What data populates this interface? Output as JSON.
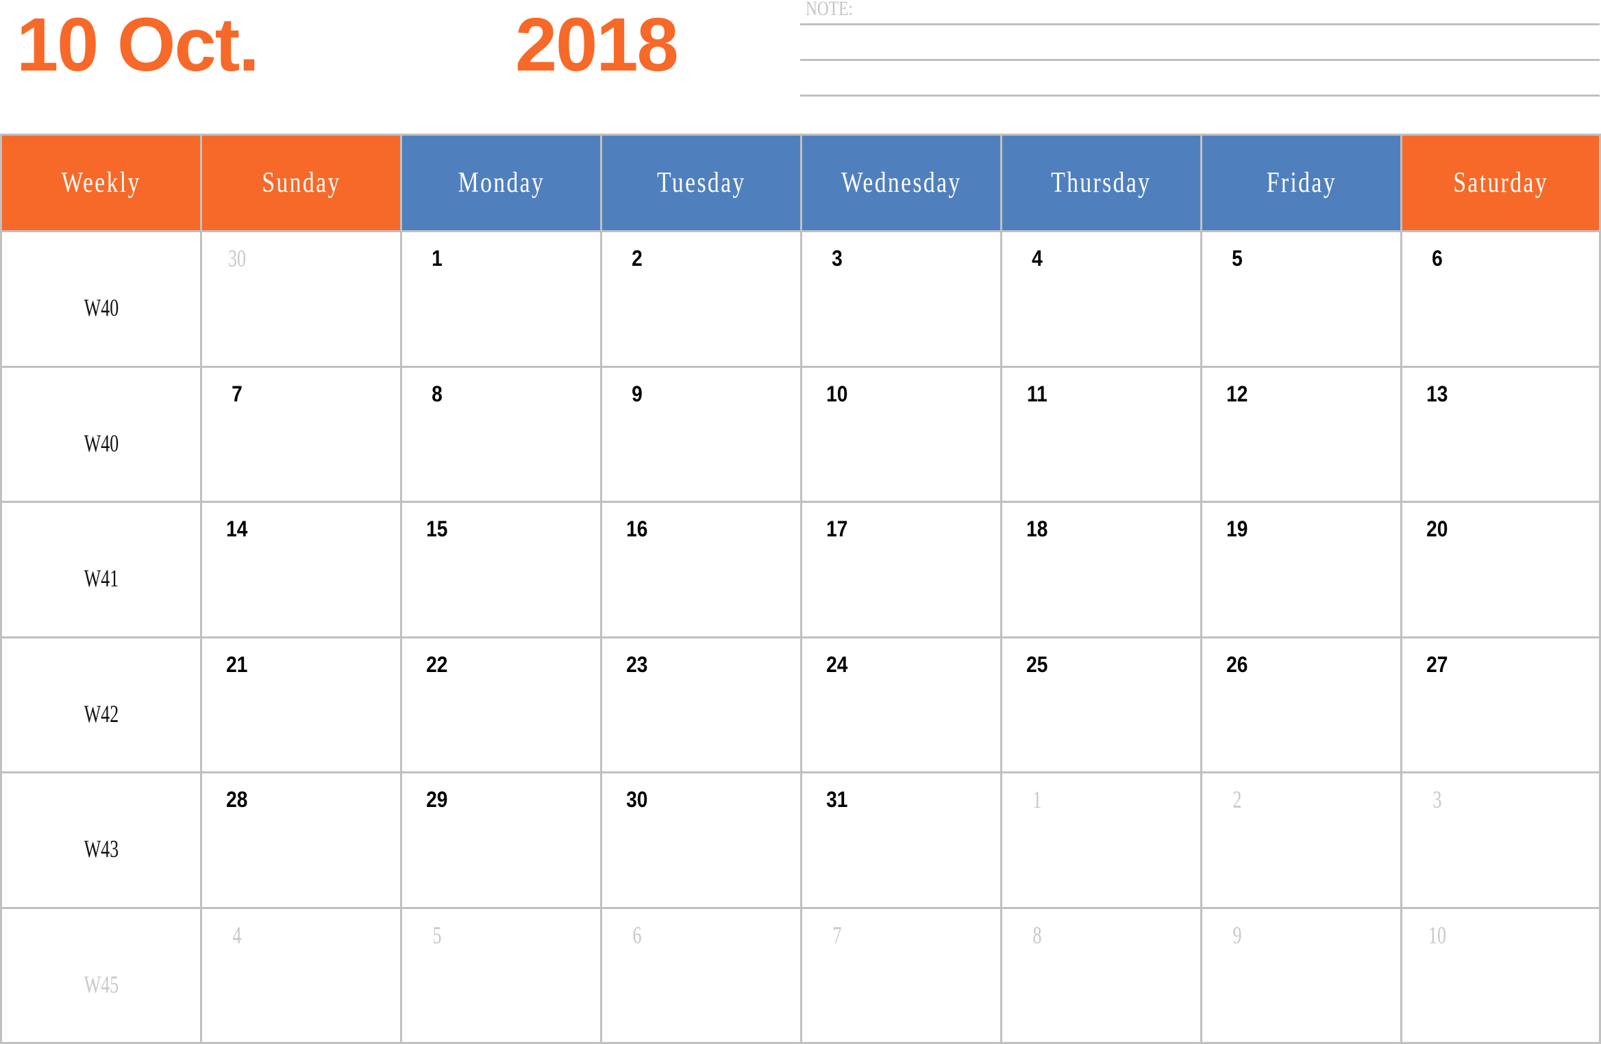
{
  "title": {
    "month_label": "10 Oct.",
    "year_label": "2018"
  },
  "note": {
    "label": "NOTE:"
  },
  "colors": {
    "accent_orange": "#f76928",
    "accent_blue": "#4f80bd",
    "grid_border": "#c0c0c0",
    "muted_text": "#c8c8c8"
  },
  "header": [
    {
      "label": "Weekly",
      "color": "#f76928"
    },
    {
      "label": "Sunday",
      "color": "#f76928"
    },
    {
      "label": "Monday",
      "color": "#4f80bd"
    },
    {
      "label": "Tuesday",
      "color": "#4f80bd"
    },
    {
      "label": "Wednesday",
      "color": "#4f80bd"
    },
    {
      "label": "Thursday",
      "color": "#4f80bd"
    },
    {
      "label": "Friday",
      "color": "#4f80bd"
    },
    {
      "label": "Saturday",
      "color": "#f76928"
    }
  ],
  "weeks": [
    {
      "label": "W40",
      "muted": false,
      "days": [
        {
          "n": "30",
          "muted": true
        },
        {
          "n": "1",
          "muted": false
        },
        {
          "n": "2",
          "muted": false
        },
        {
          "n": "3",
          "muted": false
        },
        {
          "n": "4",
          "muted": false
        },
        {
          "n": "5",
          "muted": false
        },
        {
          "n": "6",
          "muted": false
        }
      ]
    },
    {
      "label": "W40",
      "muted": false,
      "days": [
        {
          "n": "7",
          "muted": false
        },
        {
          "n": "8",
          "muted": false
        },
        {
          "n": "9",
          "muted": false
        },
        {
          "n": "10",
          "muted": false
        },
        {
          "n": "11",
          "muted": false
        },
        {
          "n": "12",
          "muted": false
        },
        {
          "n": "13",
          "muted": false
        }
      ]
    },
    {
      "label": "W41",
      "muted": false,
      "days": [
        {
          "n": "14",
          "muted": false
        },
        {
          "n": "15",
          "muted": false
        },
        {
          "n": "16",
          "muted": false
        },
        {
          "n": "17",
          "muted": false
        },
        {
          "n": "18",
          "muted": false
        },
        {
          "n": "19",
          "muted": false
        },
        {
          "n": "20",
          "muted": false
        }
      ]
    },
    {
      "label": "W42",
      "muted": false,
      "days": [
        {
          "n": "21",
          "muted": false
        },
        {
          "n": "22",
          "muted": false
        },
        {
          "n": "23",
          "muted": false
        },
        {
          "n": "24",
          "muted": false
        },
        {
          "n": "25",
          "muted": false
        },
        {
          "n": "26",
          "muted": false
        },
        {
          "n": "27",
          "muted": false
        }
      ]
    },
    {
      "label": "W43",
      "muted": false,
      "days": [
        {
          "n": "28",
          "muted": false
        },
        {
          "n": "29",
          "muted": false
        },
        {
          "n": "30",
          "muted": false
        },
        {
          "n": "31",
          "muted": false
        },
        {
          "n": "1",
          "muted": true
        },
        {
          "n": "2",
          "muted": true
        },
        {
          "n": "3",
          "muted": true
        }
      ]
    },
    {
      "label": "W45",
      "muted": true,
      "days": [
        {
          "n": "4",
          "muted": true
        },
        {
          "n": "5",
          "muted": true
        },
        {
          "n": "6",
          "muted": true
        },
        {
          "n": "7",
          "muted": true
        },
        {
          "n": "8",
          "muted": true
        },
        {
          "n": "9",
          "muted": true
        },
        {
          "n": "10",
          "muted": true
        }
      ]
    }
  ]
}
